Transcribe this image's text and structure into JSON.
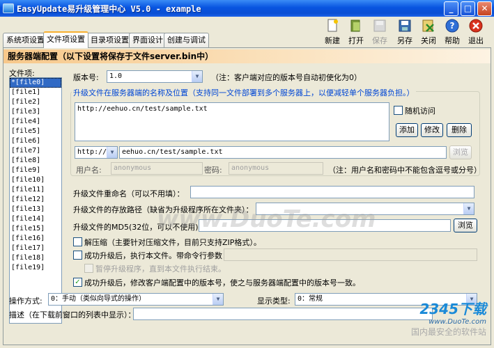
{
  "window": {
    "title": "EasyUpdate易升级管理中心 V5.0 - example"
  },
  "tabs": [
    "系统项设置",
    "文件项设置",
    "目录项设置",
    "界面设计",
    "创建与调试"
  ],
  "toolbar": {
    "new": "新建",
    "open": "打开",
    "save": "保存",
    "save_as": "另存",
    "close": "关闭",
    "help": "帮助",
    "exit": "退出"
  },
  "header": "服务器端配置（以下设置将保存于文件server.bin中）",
  "file_list": {
    "label": "文件项:",
    "items": [
      "*[file0]",
      "[file1]",
      "[file2]",
      "[file3]",
      "[file4]",
      "[file5]",
      "[file6]",
      "[file7]",
      "[file8]",
      "[file9]",
      "[file10]",
      "[file11]",
      "[file12]",
      "[file13]",
      "[file14]",
      "[file15]",
      "[file16]",
      "[file17]",
      "[file18]",
      "[file19]"
    ]
  },
  "version": {
    "label": "版本号:",
    "value": "1.0",
    "note": "（注：客户端对应的版本号自动初使化为0）"
  },
  "server_group": {
    "title": "升级文件在服务器端的名称及位置（支持同一文件部署到多个服务器上，以便减轻单个服务器负担。）",
    "url_entries": [
      "http://eehuo.cn/test/sample.txt"
    ],
    "random_access": "随机访问",
    "add": "添加",
    "modify": "修改",
    "delete": "删除",
    "protocol": "http://",
    "url_value": "eehuo.cn/test/sample.txt",
    "browse": "浏览",
    "username_label": "用户名:",
    "username_placeholder": "anonymous",
    "password_label": "密码:",
    "password_placeholder": "anonymous",
    "note": "（注：用户名和密码中不能包含逗号或分号）"
  },
  "rename": {
    "label": "升级文件重命名（可以不用填）：",
    "value": ""
  },
  "store_path": {
    "label": "升级文件的存放路径（缺省为升级程序所在文件夹）：",
    "value": ""
  },
  "md5": {
    "label": "升级文件的MD5(32位，可以不使用)：",
    "value": "",
    "browse": "浏览"
  },
  "options": {
    "unzip": "解压缩（主要针对压缩文件，目前只支持ZIP格式）。",
    "execute": "成功升级后，执行本文件。带命令行参数：",
    "pause": "暂停升级程序，直到本文件执行结束。",
    "update_version": "成功升级后，修改客户端配置中的版本号，使之与服务器端配置中的版本号一致。"
  },
  "operation": {
    "label": "操作方式:",
    "value": "0：手动（类似向导式的操作）"
  },
  "display": {
    "label": "显示类型:",
    "value": "0：常规"
  },
  "description": {
    "label": "描述（在下载前窗口的列表中显示）：",
    "value": ""
  },
  "watermark": "www.DuoTe.com",
  "brand": {
    "logo": "2345下载",
    "site": "www.DuoTe.com",
    "slogan": "国内最安全的软件站"
  }
}
